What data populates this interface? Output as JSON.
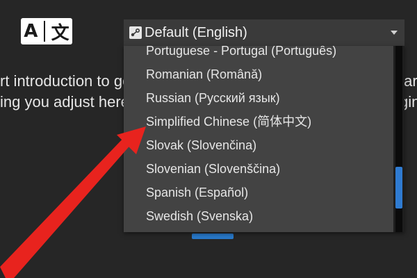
{
  "language_icon": {
    "latin_glyph": "A",
    "cjk_glyph": "文"
  },
  "intro_text": {
    "line1_left": "rt introduction to ge",
    "line2_left": "ing you adjust here",
    "line1_right": "tar",
    "line2_right": "gin"
  },
  "dropdown": {
    "selected_label": "Default (English)",
    "items": [
      "Portuguese - Portugal (Português)",
      "Romanian (Română)",
      "Russian (Русский язык)",
      "Simplified Chinese (简体中文)",
      "Slovak (Slovenčina)",
      "Slovenian (Slovenščina)",
      "Spanish (Español)",
      "Swedish (Svenska)"
    ]
  },
  "colors": {
    "background": "#262626",
    "dropdown_bg": "#434343",
    "scroll_thumb": "#2f7bd1",
    "annotation_arrow": "#e8231e"
  }
}
